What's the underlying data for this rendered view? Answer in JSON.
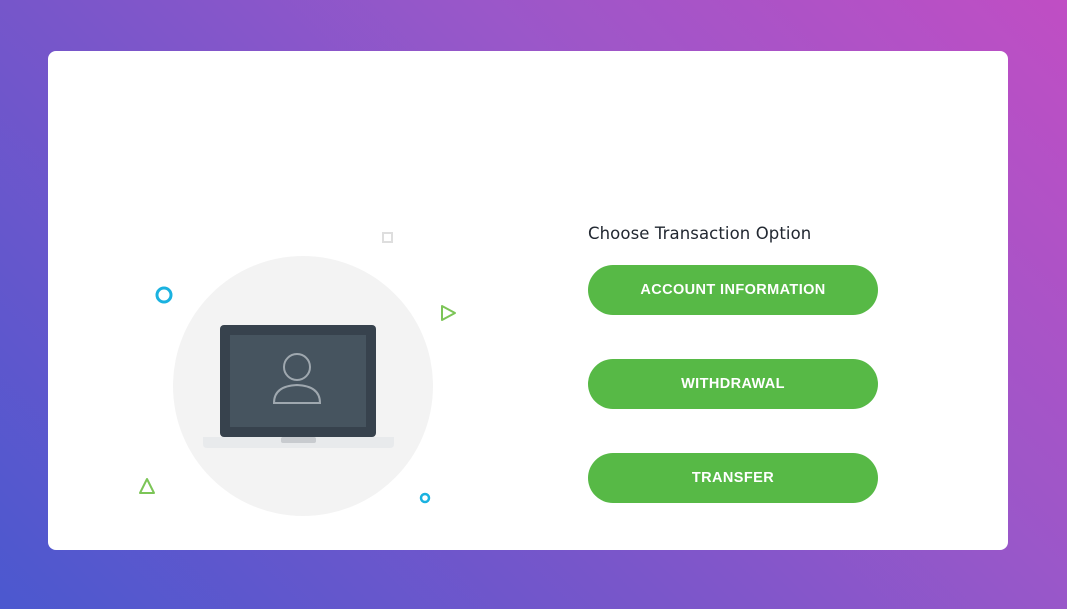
{
  "panel": {
    "heading": "Choose Transaction Option",
    "options": [
      {
        "label": "ACCOUNT INFORMATION"
      },
      {
        "label": "WITHDRAWAL"
      },
      {
        "label": "TRANSFER"
      }
    ]
  },
  "illustration": {
    "icon": "user-icon",
    "device": "laptop-icon"
  },
  "colors": {
    "button": "#57b946",
    "button_text": "#ffffff",
    "heading_text": "#222831",
    "accent_cyan": "#1ab2e0",
    "accent_green": "#7cc557",
    "laptop_frame": "#37424d",
    "laptop_screen": "#46545f",
    "circle_bg": "#f3f3f3"
  }
}
